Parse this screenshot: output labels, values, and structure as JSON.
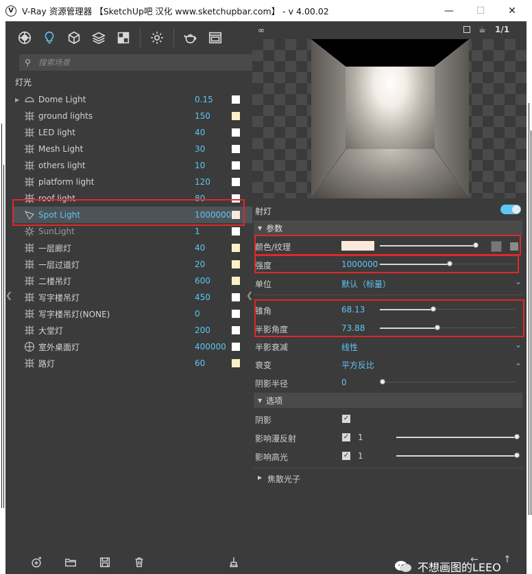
{
  "window": {
    "title": "V-Ray 资源管理器 【SketchUp吧 汉化 www.sketchupbar.com】 - v 4.00.02",
    "app_icon": "V",
    "min_symbol": "—",
    "max_symbol": "☐",
    "close_symbol": "✕"
  },
  "toolbar": {
    "icons": [
      "materials-icon",
      "lights-icon",
      "geometry-icon",
      "layers-icon",
      "textures-icon",
      "settings-icon",
      "render-teapot-icon",
      "frame-buffer-icon"
    ]
  },
  "search": {
    "placeholder": "搜索场景"
  },
  "section": {
    "label": "灯光"
  },
  "lights": [
    {
      "name": "Dome Light",
      "value": "0.15",
      "swatch": "#ffffff",
      "icon": "dome-light-icon"
    },
    {
      "name": "ground lights",
      "value": "150",
      "swatch": "#fdf0c8",
      "icon": "sphere-light-icon"
    },
    {
      "name": "LED light",
      "value": "40",
      "swatch": "#ffffff",
      "icon": "sphere-light-icon"
    },
    {
      "name": "Mesh Light",
      "value": "30",
      "swatch": "#ffffff",
      "icon": "sphere-light-icon"
    },
    {
      "name": "others light",
      "value": "10",
      "swatch": "#ffffff",
      "icon": "sphere-light-icon"
    },
    {
      "name": "platform light",
      "value": "120",
      "swatch": "#ffffff",
      "icon": "sphere-light-icon"
    },
    {
      "name": "roof light",
      "value": "80",
      "swatch": "#ffffff",
      "icon": "sphere-light-icon"
    },
    {
      "name": "Spot Light",
      "value": "1000000",
      "swatch": "#fde8dc",
      "icon": "spot-light-icon"
    },
    {
      "name": "SunLight",
      "value": "1",
      "swatch": "#ffffff",
      "icon": "sun-light-icon"
    },
    {
      "name": "一层廊灯",
      "value": "40",
      "swatch": "#fdf0c8",
      "icon": "sphere-light-icon"
    },
    {
      "name": "一层过道灯",
      "value": "20",
      "swatch": "#fdf0c8",
      "icon": "sphere-light-icon"
    },
    {
      "name": "二楼吊灯",
      "value": "600",
      "swatch": "#fdf0c8",
      "icon": "sphere-light-icon"
    },
    {
      "name": "写字楼吊灯",
      "value": "450",
      "swatch": "#ffffff",
      "icon": "sphere-light-icon"
    },
    {
      "name": "写字楼吊灯(NONE)",
      "value": "0",
      "swatch": "#ffffff",
      "icon": "sphere-light-icon"
    },
    {
      "name": "大堂灯",
      "value": "200",
      "swatch": "#ffffff",
      "icon": "sphere-light-icon"
    },
    {
      "name": "室外桌面灯",
      "value": "400000",
      "swatch": "#ffffff",
      "icon": "omni-light-icon"
    },
    {
      "name": "路灯",
      "value": "60",
      "swatch": "#fdf0c8",
      "icon": "sphere-light-icon"
    }
  ],
  "bottom_bar": {
    "icons": [
      "add-light-icon",
      "open-folder-icon",
      "save-icon",
      "delete-icon",
      "purge-icon"
    ]
  },
  "preview": {
    "ratio_label": "1/1"
  },
  "properties": {
    "title": "射灯",
    "enabled": true,
    "group_params": "参数",
    "color_label": "颜色/纹理",
    "color_value": "#fde8dc",
    "intensity_label": "强度",
    "intensity_value": "1000000",
    "units_label": "单位",
    "units_value": "默认（标量）",
    "cone_label": "锥角",
    "cone_value": "68.13",
    "penumbra_label": "半影角度",
    "penumbra_value": "73.88",
    "falloff_label": "半影衰减",
    "falloff_value": "线性",
    "decay_label": "衰变",
    "decay_value": "平方反比",
    "shadow_radius_label": "阴影半径",
    "shadow_radius_value": "0",
    "group_options": "选项",
    "shadows_label": "阴影",
    "diffuse_label": "影响漫反射",
    "diffuse_value": "1",
    "specular_label": "影响高光",
    "specular_value": "1",
    "group_caustics": "焦散光子"
  },
  "watermark": {
    "text": "不想画图的LEEO"
  },
  "colors": {
    "accent": "#5ec6f5",
    "highlight_box": "#e0282a",
    "panel": "#3b3b3b"
  }
}
